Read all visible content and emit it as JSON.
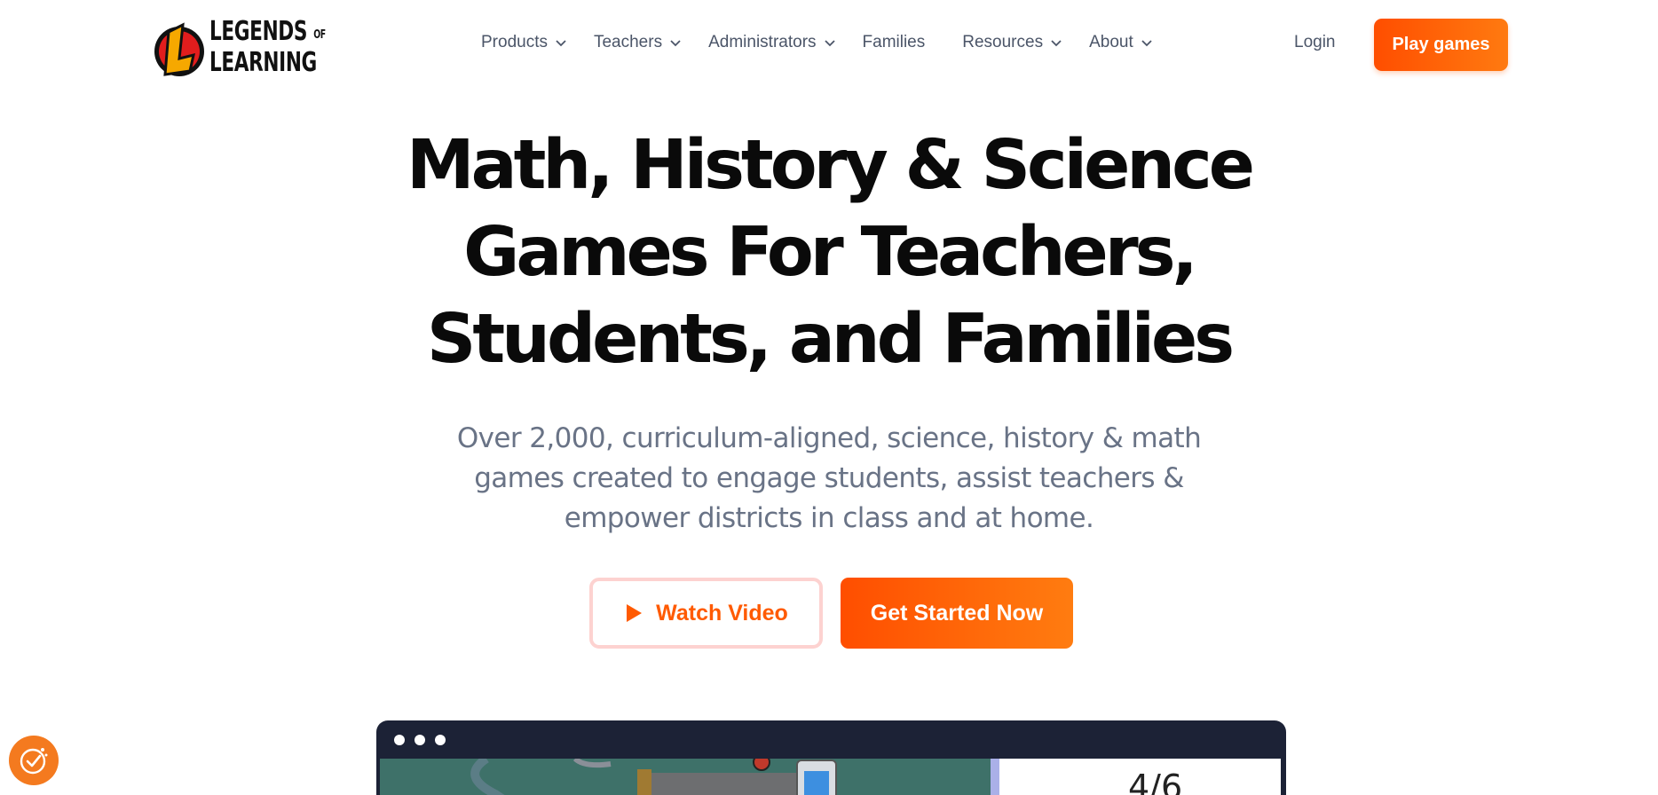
{
  "brand": {
    "logo_line1": "LEGENDS",
    "logo_of": "OF",
    "logo_line2": "LEARNING",
    "accent_color": "#ff5a00",
    "logo_mark_color": "#f6a800"
  },
  "nav": {
    "items": [
      {
        "label": "Products",
        "has_dropdown": true
      },
      {
        "label": "Teachers",
        "has_dropdown": true
      },
      {
        "label": "Administrators",
        "has_dropdown": true
      },
      {
        "label": "Families",
        "has_dropdown": false
      },
      {
        "label": "Resources",
        "has_dropdown": true
      },
      {
        "label": "About",
        "has_dropdown": true
      }
    ],
    "login_label": "Login",
    "play_label": "Play games"
  },
  "hero": {
    "title_lines": [
      "Math, History & Science",
      "Games For Teachers,",
      "Students, and Families"
    ],
    "subtitle_lines": [
      "Over 2,000, curriculum-aligned, science, history & math",
      "games created to engage students, assist teachers &",
      "empower districts in class and at home."
    ],
    "watch_label": "Watch Video",
    "start_label": "Get Started Now"
  },
  "preview": {
    "score": "4/6"
  },
  "icons": {
    "chevron": "chevron-down-icon",
    "play": "play-icon",
    "badge": "cookie-consent-icon"
  }
}
